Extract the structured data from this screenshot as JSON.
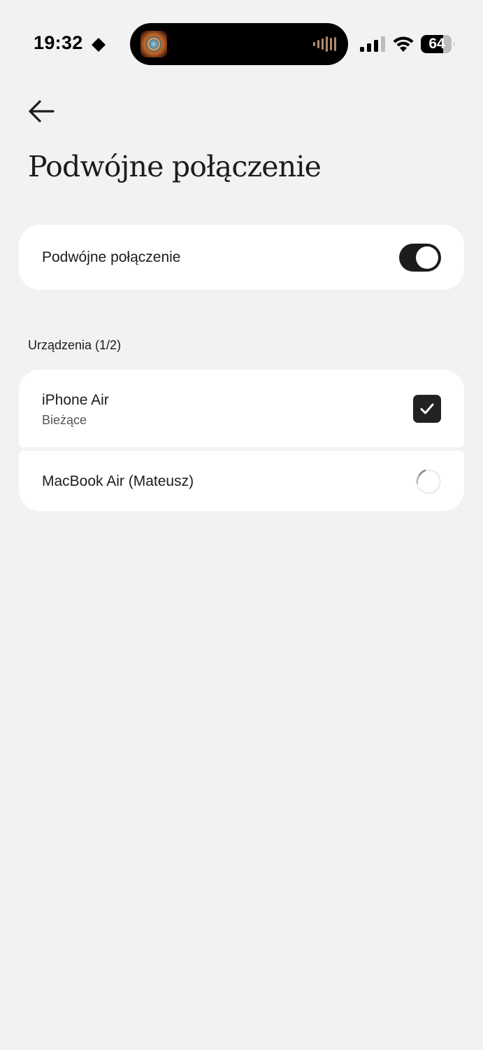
{
  "status_bar": {
    "time": "19:32",
    "battery": "64",
    "focus_icon": "diamond-icon",
    "signal_icon": "cellular-signal-icon",
    "wifi_icon": "wifi-icon",
    "battery_icon": "battery-icon",
    "island_icons": [
      "now-playing-artwork-icon",
      "audio-waveform-icon"
    ]
  },
  "header": {
    "back_icon": "back-arrow-icon",
    "title": "Podwójne połączenie"
  },
  "dual_connection": {
    "label": "Podwójne połączenie",
    "enabled": true
  },
  "devices": {
    "section_label": "Urządzenia (1/2)",
    "items": [
      {
        "name": "iPhone Air",
        "subtitle": "Bieżące",
        "state": "checked",
        "icon": "checkbox-checked-icon"
      },
      {
        "name": "MacBook Air (Mateusz)",
        "subtitle": "",
        "state": "connecting",
        "icon": "loading-spinner-icon"
      }
    ]
  },
  "colors": {
    "background": "#f2f2f2",
    "card": "#ffffff",
    "accent_dark": "#1c1c1c"
  }
}
